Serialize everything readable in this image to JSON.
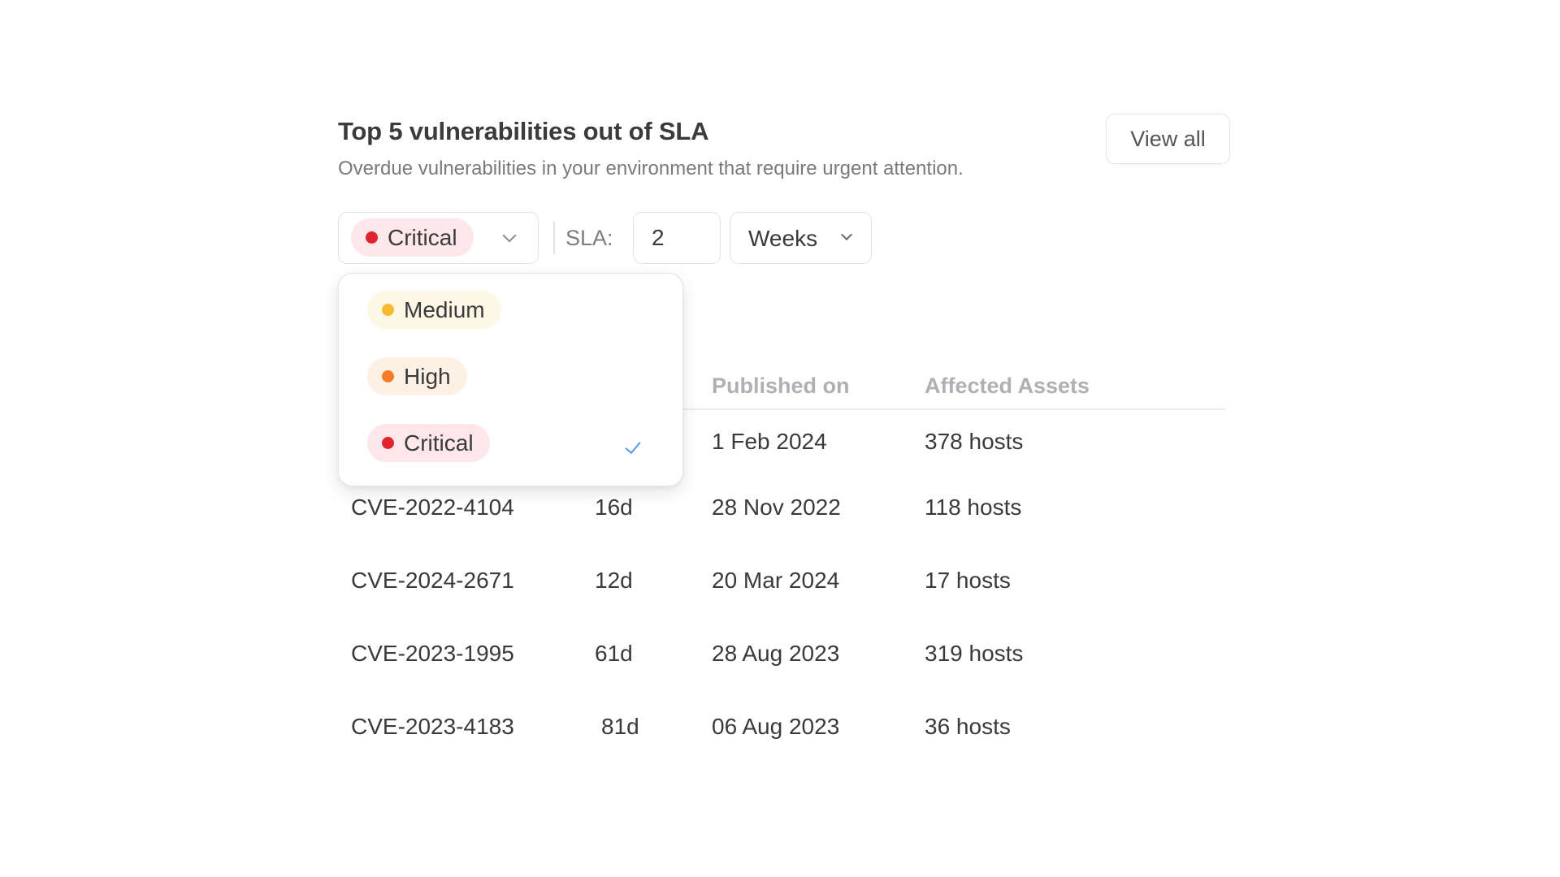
{
  "header": {
    "title": "Top 5 vulnerabilities out of SLA",
    "subtitle": "Overdue vulnerabilities in your environment that require urgent attention.",
    "view_all_label": "View all"
  },
  "filters": {
    "severity": {
      "selected": "Critical",
      "selected_color": "#e0242f",
      "selected_bg": "#fde7ea",
      "options": [
        {
          "label": "Medium",
          "dot_color": "#f7b92f",
          "bg_color": "#fdf7e6",
          "selected": false
        },
        {
          "label": "High",
          "dot_color": "#f57d25",
          "bg_color": "#fdf0e4",
          "selected": true,
          "_note": ""
        },
        {
          "label": "Critical",
          "dot_color": "#e0242f",
          "bg_color": "#fde7ea",
          "selected": true
        }
      ],
      "check_icon": "checkmark-icon",
      "check_color": "#5a9be8"
    },
    "sla_label": "SLA:",
    "sla_value": "2",
    "sla_unit": "Weeks"
  },
  "table": {
    "columns": [
      "",
      "",
      "Published on",
      "Affected Assets"
    ],
    "rows": [
      {
        "cve": "",
        "overdue": "",
        "published": "1 Feb 2024",
        "assets": "378 hosts"
      },
      {
        "cve": "CVE-2022-4104",
        "overdue": "16d",
        "published": "28 Nov 2022",
        "assets": "118 hosts"
      },
      {
        "cve": "CVE-2024-2671",
        "overdue": "12d",
        "published": "20 Mar 2024",
        "assets": "17 hosts"
      },
      {
        "cve": "CVE-2023-1995",
        "overdue": "61d",
        "published": "28 Aug 2023",
        "assets": "319 hosts"
      },
      {
        "cve": "CVE-2023-4183",
        "overdue": "81d",
        "published": "06 Aug 2023",
        "assets": "36 hosts"
      }
    ]
  }
}
